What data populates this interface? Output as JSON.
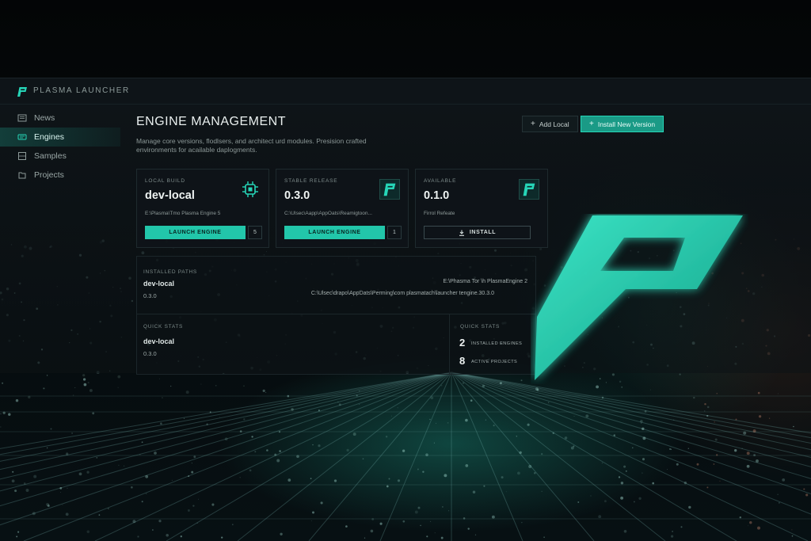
{
  "app": {
    "title": "PLASMA LAUNCHER"
  },
  "sidebar": {
    "items": [
      {
        "label": "News",
        "icon": "newspaper-icon",
        "active": false
      },
      {
        "label": "Engines",
        "icon": "engine-icon",
        "active": true
      },
      {
        "label": "Samples",
        "icon": "samples-icon",
        "active": false
      },
      {
        "label": "Projects",
        "icon": "projects-icon",
        "active": false
      }
    ]
  },
  "header": {
    "title": "ENGINE MANAGEMENT",
    "description": "Manage core versions, flodlsers, and architect urd modules. Presision crafted environments for acailable daplogments.",
    "add_local_label": "Add Local",
    "install_new_label": "Install New Version"
  },
  "cards": [
    {
      "label": "LOCAL BUILD",
      "version": "dev-local",
      "path": "E:\\Plasma\\Tmo Plasma Engine 5",
      "button": "LAUNCH ENGINE",
      "count": "5",
      "icon": "chip-icon"
    },
    {
      "label": "STABLE RELEASE",
      "version": "0.3.0",
      "path": "C:\\Ulsec\\Aapp\\AppOats\\Reamigtoon...",
      "button": "LAUNCH ENGINE",
      "count": "1",
      "icon": "plasma-logo-icon"
    },
    {
      "label": "AVAILABLE",
      "version": "0.1.0",
      "path": "Firrol Refeate",
      "button": "INSTALL",
      "icon": "plasma-logo-icon"
    }
  ],
  "installed_paths": {
    "label": "INSTALLED PATHS",
    "name": "dev-local",
    "version": "0.3.0",
    "path_right_1": "E:\\Phasma Tor \\h PlasmaEngine 2",
    "path_right_2": "C:\\Ulsec\\drapo\\AppDats\\Perming\\com plasmatach\\launcher tengine.30.3.0"
  },
  "quick_stats_left": {
    "label": "QUICK STATS",
    "name": "dev-local",
    "version": "0.3.0"
  },
  "quick_stats_right": {
    "label": "QUICK STATS",
    "installed_count": "2",
    "installed_label": "INSTALLED ENGINES",
    "projects_count": "8",
    "projects_label": "ACTIVE PROJECTS"
  },
  "colors": {
    "accent": "#26d6b8",
    "accent_dark": "#1a9a86",
    "background": "#05080a"
  }
}
